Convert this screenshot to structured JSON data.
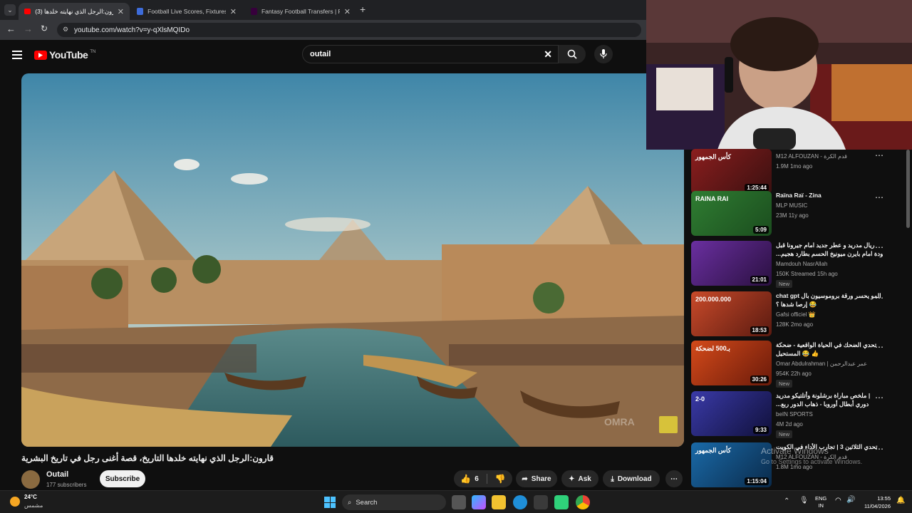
{
  "browser": {
    "tabs": [
      {
        "title": "قارون:الرجل الذي نهايته خلدها (3)",
        "active": true
      },
      {
        "title": "Football Live Scores, Fixtures &",
        "active": false
      },
      {
        "title": "Fantasy Football Transfers | Fan",
        "active": false
      }
    ],
    "url": "youtube.com/watch?v=y-qXlsMQIDo"
  },
  "youtube": {
    "logo": "YouTube",
    "logo_sup": "TN",
    "search_value": "outail"
  },
  "video": {
    "watermark": "OMRA"
  },
  "meta": {
    "title": "قارون:الرجل الذي نهايته خلدها التاريخ، قصة أغنى رجل في تاريخ البشرية",
    "channel": "Outail",
    "subscribers": "177 subscribers",
    "subscribe": "Subscribe",
    "likes": "6",
    "share": "Share",
    "ask": "Ask",
    "download": "Download"
  },
  "recommendations": [
    {
      "title": "",
      "channel": "M12 ALFOUZAN - قدم الكرة",
      "meta": "1.9M  1mo ago",
      "duration": "1:25:44",
      "new": "",
      "thumb_text": "كأس الجمهور",
      "c1": "#8b1e1e",
      "c2": "#3a1010"
    },
    {
      "title": "Raïna Raï - Zina",
      "channel": "MLP MUSIC",
      "meta": "23M  11y ago",
      "duration": "5:09",
      "new": "",
      "thumb_text": "RAINA RAI",
      "c1": "#2f7d32",
      "c2": "#1b4d1e"
    },
    {
      "title": "ريال مدريد و عطر جديد امام جيرونا قبل",
      "title2": "...عودة امام بايرن ميونيخ الحسم بطارد هجيم",
      "channel": "Mamdouh NasrAllah",
      "meta": "150K  Streamed 15h ago",
      "duration": "21:01",
      "new": "New",
      "thumb_text": "",
      "c1": "#6a2fa0",
      "c2": "#2a1040"
    },
    {
      "title": "chat gpt المو يحسر ورقة بروموسيون بال",
      "title2": "إرصا شدها ؟ 😂",
      "channel": "Gafsi officiel 👑",
      "meta": "128K  2mo ago",
      "duration": "18:53",
      "new": "",
      "thumb_text": "200.000.000",
      "c1": "#c94a2a",
      "c2": "#5a1a10"
    },
    {
      "title": "تحدي الضحك في الحياة الواقعية - ضحكة",
      "title2": "المستحيل 😂 👍",
      "channel": "Omar Abdulrahman | عمر عبدالرحمن",
      "meta": "954K  22h ago",
      "duration": "30:26",
      "new": "New",
      "thumb_text": "بـ500 لضحكة",
      "c1": "#d44a1a",
      "c2": "#6a1a0a"
    },
    {
      "title": "ملخص مباراة برشلونة وأتلتيكو مدريد |",
      "title2": "...دوري أبطال أوروبا - ذهاب الدور ربع",
      "channel": "beIN SPORTS",
      "meta": "4M  2d ago",
      "duration": "9:33",
      "new": "New",
      "thumb_text": "2-0",
      "c1": "#3a3aa8",
      "c2": "#10103a"
    },
    {
      "title": "تحدي الثلاثين 3 | تجارب الأداء في الكويت",
      "channel": "M12 ALFOUZAN - قدم الكرة",
      "meta": "1.8M  1mo ago",
      "duration": "1:15:04",
      "new": "",
      "thumb_text": "كأس الجمهور",
      "c1": "#1a6aa8",
      "c2": "#0a2a4a"
    }
  ],
  "windows": {
    "activate_title": "Activate Windows",
    "activate_sub": "Go to Settings to activate Windows."
  },
  "taskbar": {
    "weather_temp": "24°C",
    "weather_desc": "مشمس",
    "search": "Search",
    "lang1": "ENG",
    "lang2": "IN",
    "time": "13:55",
    "date": "11/04/2026"
  }
}
